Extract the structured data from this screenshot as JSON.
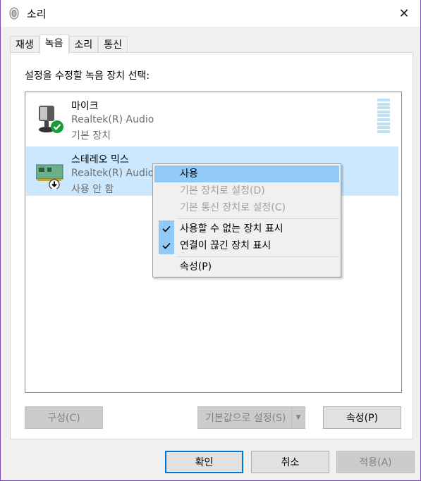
{
  "window": {
    "title": "소리"
  },
  "tabs": [
    "재생",
    "녹음",
    "소리",
    "통신"
  ],
  "active_tab": "녹음",
  "instruction": "설정을 수정할 녹음 장치 선택:",
  "devices": [
    {
      "name": "마이크",
      "driver": "Realtek(R) Audio",
      "status": "기본 장치",
      "icon": "microphone-icon",
      "badge": "green-check-badge"
    },
    {
      "name": "스테레오 믹스",
      "driver": "Realtek(R) Audio",
      "status": "사용 안 함",
      "icon": "sound-card-icon",
      "badge": "down-arrow-badge"
    }
  ],
  "context_menu": [
    {
      "label": "사용",
      "state": "highlighted"
    },
    {
      "label": "기본 장치로 설정(D)",
      "state": "disabled"
    },
    {
      "label": "기본 통신 장치로 설정(C)",
      "state": "disabled"
    },
    {
      "label": "사용할 수 없는 장치 표시",
      "state": "checked"
    },
    {
      "label": "연결이 끊긴 장치 표시",
      "state": "checked"
    },
    {
      "label": "속성(P)",
      "state": "normal"
    }
  ],
  "panel_buttons": {
    "configure": "구성(C)",
    "set_default": "기본값으로 설정(S)",
    "properties": "속성(P)"
  },
  "footer_buttons": {
    "ok": "확인",
    "cancel": "취소",
    "apply": "적용(A)"
  }
}
